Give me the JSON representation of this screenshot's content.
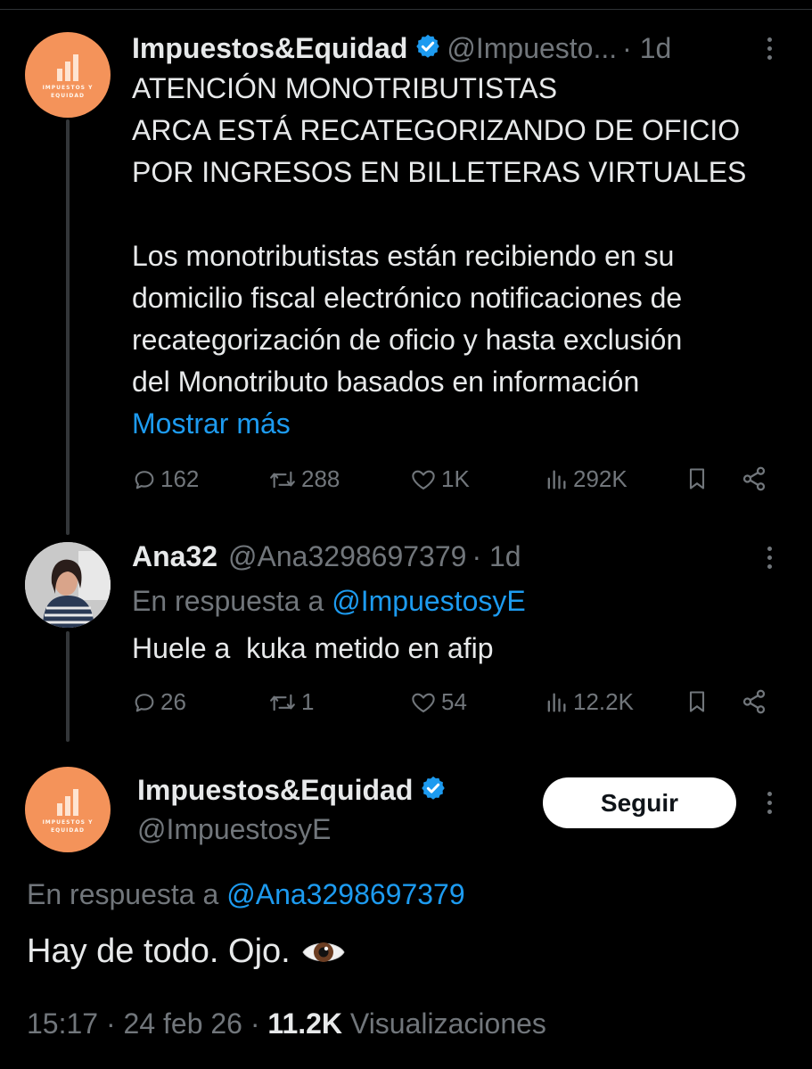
{
  "tweet1": {
    "author": "Impuestos&Equidad",
    "handle": "@Impuesto...",
    "time": "· 1d",
    "avatar_text": "IMPUESTOS Y EQUIDAD",
    "lines": [
      "ATENCIÓN MONOTRIBUTISTAS",
      "ARCA ESTÁ RECATEGORIZANDO DE OFICIO",
      "POR INGRESOS EN BILLETERAS VIRTUALES",
      "",
      "Los monotributistas están recibiendo en su",
      "domicilio fiscal electrónico notificaciones de",
      "recategorización de oficio y hasta exclusión",
      "del Monotributo basados en información"
    ],
    "show_more": "Mostrar más",
    "replies": "162",
    "reposts": "288",
    "likes": "1K",
    "views": "292K"
  },
  "tweet2": {
    "author": "Ana32",
    "handle": "@Ana3298697379",
    "time": "· 1d",
    "reply_prefix": "En respuesta a",
    "reply_to": "@ImpuestosyE",
    "text": "Huele a  kuka metido en afip",
    "replies": "26",
    "reposts": "1",
    "likes": "54",
    "views": "12.2K"
  },
  "tweet3": {
    "author": "Impuestos&Equidad",
    "handle": "@ImpuestosyE",
    "avatar_text": "IMPUESTOS Y EQUIDAD",
    "follow_label": "Seguir",
    "reply_prefix": "En respuesta a",
    "reply_to": "@Ana3298697379",
    "text": "Hay de todo. Ojo.",
    "timestamp": "15:17 · 24 feb 26 ·",
    "view_count": "11.2K",
    "view_label": "Visualizaciones"
  },
  "colors": {
    "background": "#000000",
    "text": "#e7e9ea",
    "muted": "#71767b",
    "link": "#1d9bf0",
    "avatar_orange": "#f4935a"
  }
}
